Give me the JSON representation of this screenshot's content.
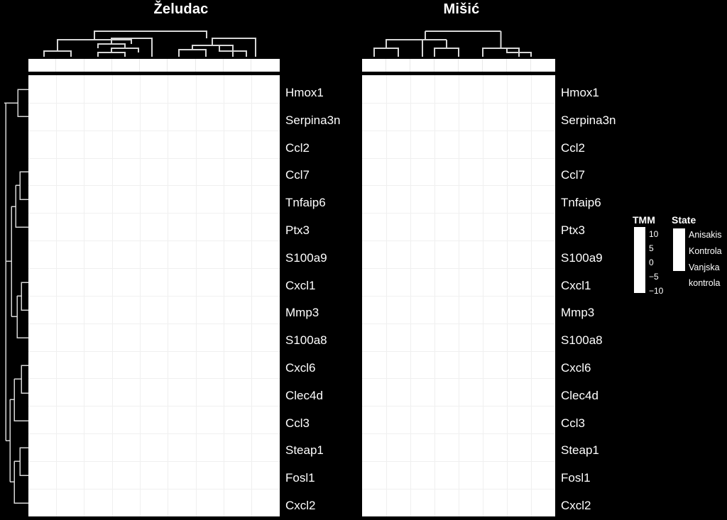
{
  "figure": {
    "background_color": "#000000",
    "foreground_color": "#ffffff",
    "cell_color": "#ffffff",
    "grid_color": "#efefef"
  },
  "panels": [
    {
      "title": "Želudac",
      "n_columns": 9,
      "column_annotation_name": "State"
    },
    {
      "title": "Mišić",
      "n_columns": 8,
      "column_annotation_name": "State"
    }
  ],
  "rows": [
    "Hmox1",
    "Serpina3n",
    "Ccl2",
    "Ccl7",
    "Tnfaip6",
    "Ptx3",
    "S100a9",
    "Cxcl1",
    "Mmp3",
    "S100a8",
    "Cxcl6",
    "Clec4d",
    "Ccl3",
    "Steap1",
    "Fosl1",
    "Cxcl2"
  ],
  "legends": {
    "tmm": {
      "title": "TMM",
      "ticks": [
        "10",
        "5",
        "0",
        "−5",
        "−10"
      ],
      "range": [
        -10,
        10
      ]
    },
    "state": {
      "title": "State",
      "items": [
        "Anisakis",
        "Kontrola",
        "Vanjska",
        "kontrola"
      ]
    }
  },
  "chart_data": {
    "type": "heatmap",
    "title": "",
    "panels": [
      {
        "title": "Želudac",
        "columns": 9,
        "rows": [
          "Hmox1",
          "Serpina3n",
          "Ccl2",
          "Ccl7",
          "Tnfaip6",
          "Ptx3",
          "S100a9",
          "Cxcl1",
          "Mmp3",
          "S100a8",
          "Cxcl6",
          "Clec4d",
          "Ccl3",
          "Steap1",
          "Fosl1",
          "Cxcl2"
        ],
        "values": "not-rendered",
        "col_dendrogram": true,
        "row_dendrogram": true,
        "col_annotation": "State"
      },
      {
        "title": "Mišić",
        "columns": 8,
        "rows": [
          "Hmox1",
          "Serpina3n",
          "Ccl2",
          "Ccl7",
          "Tnfaip6",
          "Ptx3",
          "S100a9",
          "Cxcl1",
          "Mmp3",
          "S100a8",
          "Cxcl6",
          "Clec4d",
          "Ccl3",
          "Steap1",
          "Fosl1",
          "Cxcl2"
        ],
        "values": "not-rendered",
        "col_dendrogram": true,
        "row_dendrogram": false,
        "col_annotation": "State"
      }
    ],
    "colorbar": {
      "label": "TMM",
      "ticks": [
        10,
        5,
        0,
        -5,
        -10
      ],
      "vmin": -10,
      "vmax": 10
    },
    "categorical_legend": {
      "label": "State",
      "categories": [
        "Anisakis",
        "Kontrola",
        "Vanjska kontrola"
      ]
    },
    "grid": true,
    "legend_position": "right"
  }
}
